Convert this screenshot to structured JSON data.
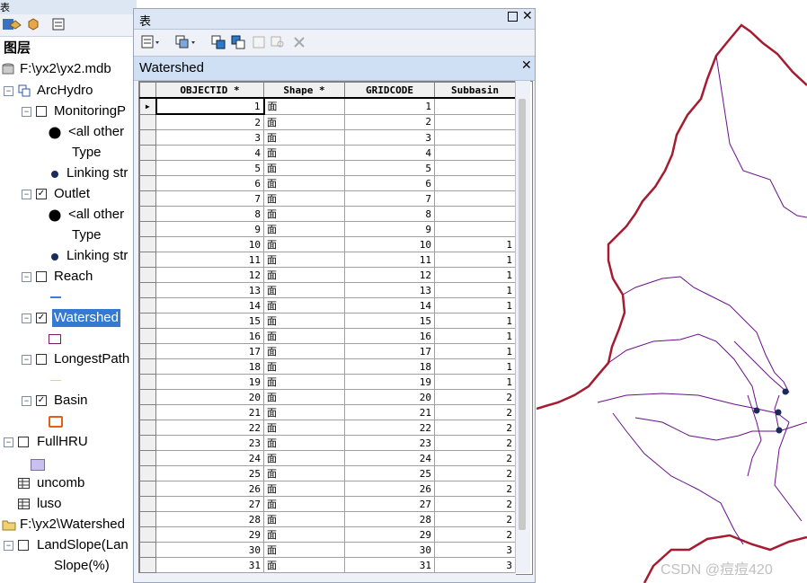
{
  "toc": {
    "title": "表",
    "items": [
      {
        "label": "图层"
      },
      {
        "label": "F:\\yx2\\yx2.mdb"
      },
      {
        "label": "ArcHydro"
      },
      {
        "label": "MonitoringP"
      },
      {
        "label": "<all other"
      },
      {
        "label": "Type"
      },
      {
        "label": "Linking str"
      },
      {
        "label": "Outlet"
      },
      {
        "label": "<all other"
      },
      {
        "label": "Type"
      },
      {
        "label": "Linking str"
      },
      {
        "label": "Reach"
      },
      {
        "label": "Watershed"
      },
      {
        "label": "LongestPath"
      },
      {
        "label": "Basin"
      },
      {
        "label": "FullHRU"
      },
      {
        "label": "uncomb"
      },
      {
        "label": "luso"
      },
      {
        "label": "F:\\yx2\\Watershed"
      },
      {
        "label": "LandSlope(Lan"
      },
      {
        "label": "Slope(%)"
      }
    ]
  },
  "table_window": {
    "title": "表",
    "layer_tab": "Watershed",
    "columns": [
      "OBJECTID *",
      "Shape *",
      "GRIDCODE",
      "Subbasin"
    ],
    "rows": [
      {
        "id": "1",
        "shape": "面",
        "gridcode": "1",
        "sub": ""
      },
      {
        "id": "2",
        "shape": "面",
        "gridcode": "2",
        "sub": ""
      },
      {
        "id": "3",
        "shape": "面",
        "gridcode": "3",
        "sub": ""
      },
      {
        "id": "4",
        "shape": "面",
        "gridcode": "4",
        "sub": ""
      },
      {
        "id": "5",
        "shape": "面",
        "gridcode": "5",
        "sub": ""
      },
      {
        "id": "6",
        "shape": "面",
        "gridcode": "6",
        "sub": ""
      },
      {
        "id": "7",
        "shape": "面",
        "gridcode": "7",
        "sub": ""
      },
      {
        "id": "8",
        "shape": "面",
        "gridcode": "8",
        "sub": ""
      },
      {
        "id": "9",
        "shape": "面",
        "gridcode": "9",
        "sub": ""
      },
      {
        "id": "10",
        "shape": "面",
        "gridcode": "10",
        "sub": "1"
      },
      {
        "id": "11",
        "shape": "面",
        "gridcode": "11",
        "sub": "1"
      },
      {
        "id": "12",
        "shape": "面",
        "gridcode": "12",
        "sub": "1"
      },
      {
        "id": "13",
        "shape": "面",
        "gridcode": "13",
        "sub": "1"
      },
      {
        "id": "14",
        "shape": "面",
        "gridcode": "14",
        "sub": "1"
      },
      {
        "id": "15",
        "shape": "面",
        "gridcode": "15",
        "sub": "1"
      },
      {
        "id": "16",
        "shape": "面",
        "gridcode": "16",
        "sub": "1"
      },
      {
        "id": "17",
        "shape": "面",
        "gridcode": "17",
        "sub": "1"
      },
      {
        "id": "18",
        "shape": "面",
        "gridcode": "18",
        "sub": "1"
      },
      {
        "id": "19",
        "shape": "面",
        "gridcode": "19",
        "sub": "1"
      },
      {
        "id": "20",
        "shape": "面",
        "gridcode": "20",
        "sub": "2"
      },
      {
        "id": "21",
        "shape": "面",
        "gridcode": "21",
        "sub": "2"
      },
      {
        "id": "22",
        "shape": "面",
        "gridcode": "22",
        "sub": "2"
      },
      {
        "id": "23",
        "shape": "面",
        "gridcode": "23",
        "sub": "2"
      },
      {
        "id": "24",
        "shape": "面",
        "gridcode": "24",
        "sub": "2"
      },
      {
        "id": "25",
        "shape": "面",
        "gridcode": "25",
        "sub": "2"
      },
      {
        "id": "26",
        "shape": "面",
        "gridcode": "26",
        "sub": "2"
      },
      {
        "id": "27",
        "shape": "面",
        "gridcode": "27",
        "sub": "2"
      },
      {
        "id": "28",
        "shape": "面",
        "gridcode": "28",
        "sub": "2"
      },
      {
        "id": "29",
        "shape": "面",
        "gridcode": "29",
        "sub": "2"
      },
      {
        "id": "30",
        "shape": "面",
        "gridcode": "30",
        "sub": "3"
      },
      {
        "id": "31",
        "shape": "面",
        "gridcode": "31",
        "sub": "3"
      }
    ]
  },
  "colors": {
    "basin_outline": "#a51c30",
    "watershed_line": "#6a0f8a",
    "selection": "#3579d1"
  },
  "watermark": "CSDN @痘痘420"
}
